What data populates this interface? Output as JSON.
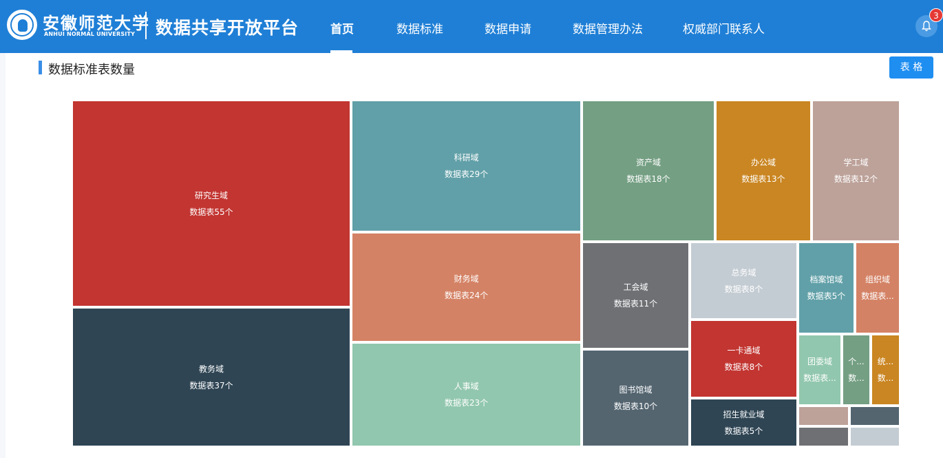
{
  "header": {
    "university_cn": "安徽师范大学",
    "university_en": "ANHUI NORMAL UNIVERSITY",
    "platform": "数据共享开放平台",
    "nav": [
      "首页",
      "数据标准",
      "数据申请",
      "数据管理办法",
      "权威部门联系人"
    ],
    "active_nav": "首页",
    "notification_count": "3",
    "accent": "#1f7fd6"
  },
  "section": {
    "title": "数据标准表数量",
    "table_button": "表 格"
  },
  "chart_data": {
    "type": "treemap",
    "unit_prefix": "数据表",
    "unit_suffix": "个",
    "items": [
      {
        "name": "研究生域",
        "label2": "数据表55个",
        "value": 55,
        "color": "#c23531"
      },
      {
        "name": "教务域",
        "label2": "数据表37个",
        "value": 37,
        "color": "#2f4554"
      },
      {
        "name": "科研域",
        "label2": "数据表29个",
        "value": 29,
        "color": "#61a0a8"
      },
      {
        "name": "财务域",
        "label2": "数据表24个",
        "value": 24,
        "color": "#d48265"
      },
      {
        "name": "人事域",
        "label2": "数据表23个",
        "value": 23,
        "color": "#91c7ae"
      },
      {
        "name": "资产域",
        "label2": "数据表18个",
        "value": 18,
        "color": "#749f83"
      },
      {
        "name": "办公域",
        "label2": "数据表13个",
        "value": 13,
        "color": "#ca8622"
      },
      {
        "name": "学工域",
        "label2": "数据表12个",
        "value": 12,
        "color": "#bda29a"
      },
      {
        "name": "工会域",
        "label2": "数据表11个",
        "value": 11,
        "color": "#6e7074"
      },
      {
        "name": "图书馆域",
        "label2": "数据表10个",
        "value": 10,
        "color": "#546570"
      },
      {
        "name": "总务域",
        "label2": "数据表8个",
        "value": 8,
        "color": "#c4ccd3"
      },
      {
        "name": "一卡通域",
        "label2": "数据表8个",
        "value": 8,
        "color": "#c23531"
      },
      {
        "name": "招生就业域",
        "label2": "数据表5个",
        "value": 5,
        "color": "#2f4554"
      },
      {
        "name": "档案馆域",
        "label2": "数据表5个",
        "value": 5,
        "color": "#61a0a8"
      },
      {
        "name": "组织域",
        "label2": "数据表...",
        "value": 4,
        "color": "#d48265"
      },
      {
        "name": "团委域",
        "label2": "数据表...",
        "value": 3,
        "color": "#91c7ae"
      },
      {
        "name": "个...",
        "label2": "数...",
        "value": 2,
        "color": "#749f83"
      },
      {
        "name": "统...",
        "label2": "数...",
        "value": 2,
        "color": "#ca8622"
      },
      {
        "name": "",
        "label2": "",
        "value": 1,
        "color": "#bda29a"
      },
      {
        "name": "",
        "label2": "",
        "value": 1,
        "color": "#546570"
      },
      {
        "name": "",
        "label2": "",
        "value": 1,
        "color": "#6e7074"
      },
      {
        "name": "",
        "label2": "",
        "value": 1,
        "color": "#c4ccd3"
      }
    ]
  }
}
